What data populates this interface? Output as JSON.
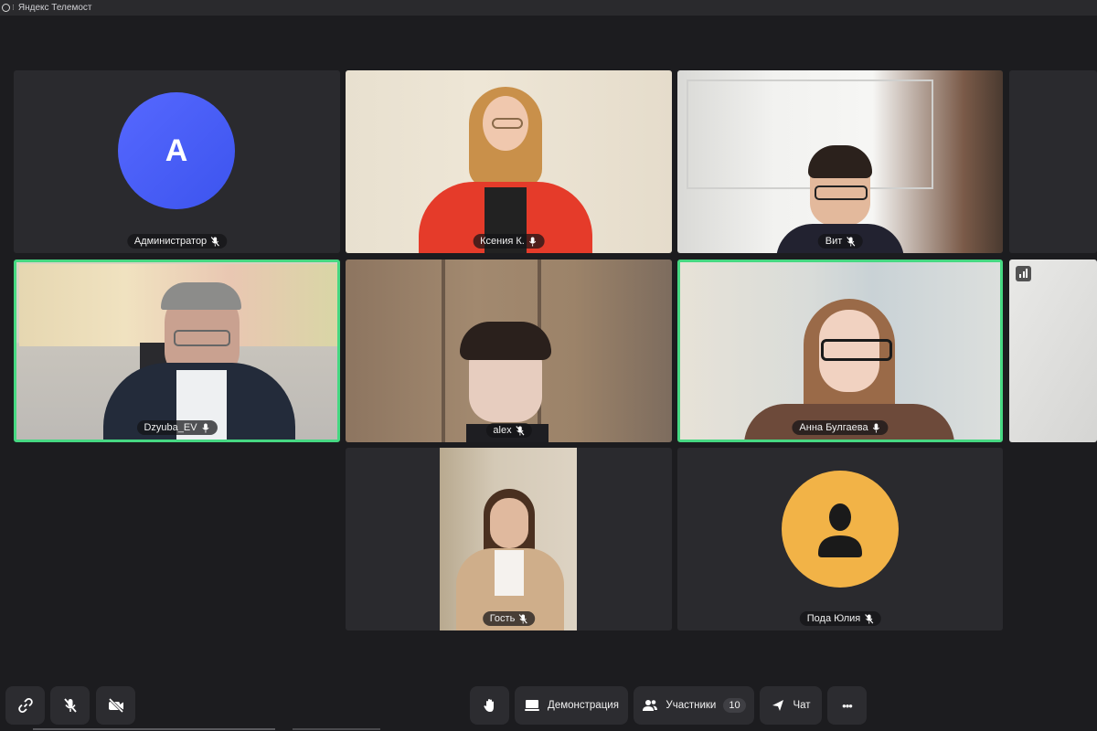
{
  "window": {
    "title": "Яндекс Телемост"
  },
  "participants": {
    "admin": {
      "name": "Администратор",
      "initial": "A"
    },
    "ksenia": {
      "name": "Ксения К."
    },
    "vit": {
      "name": "Вит"
    },
    "dzyuba": {
      "name": "Dzyuba_EV"
    },
    "alex": {
      "name": "alex"
    },
    "anna": {
      "name": "Анна Булгаева"
    },
    "guest": {
      "name": "Гость"
    },
    "poda": {
      "name": "Пода Юлия"
    }
  },
  "toolbar": {
    "screen_share_label": "Демонстрация",
    "participants_label": "Участники",
    "participants_count": "10",
    "chat_label": "Чат",
    "more_label": "•••"
  },
  "colors": {
    "active_border": "#46d882",
    "admin_avatar": "#4a5cf5",
    "guest_avatar": "#f2b347",
    "background": "#1c1c1f"
  }
}
